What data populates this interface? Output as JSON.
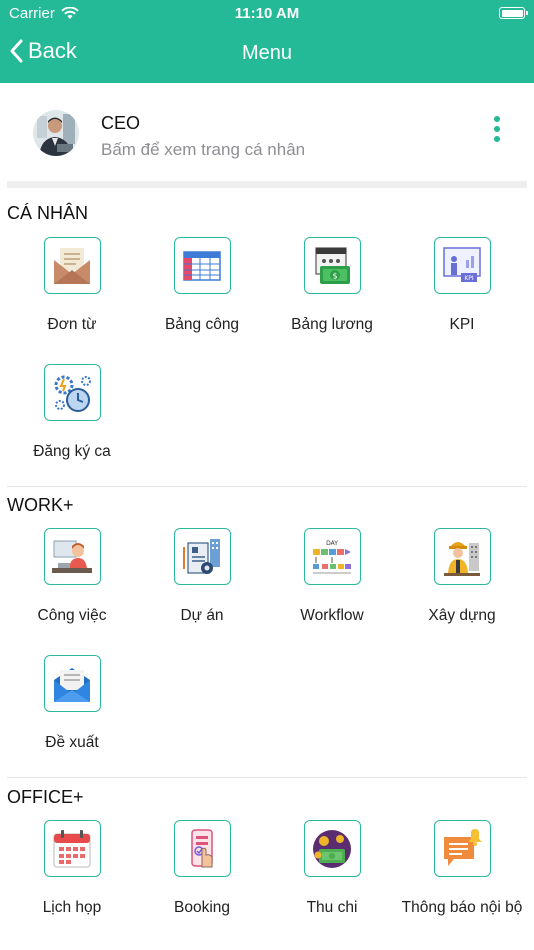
{
  "status_bar": {
    "carrier": "Carrier",
    "time": "11:10 AM"
  },
  "nav": {
    "back_label": "Back",
    "title": "Menu"
  },
  "profile": {
    "name": "CEO",
    "subtitle": "Bấm để xem trang cá nhân"
  },
  "sections": [
    {
      "title": "CÁ NHÂN",
      "items": [
        {
          "label": "Đơn từ",
          "icon": "letter-envelope-icon"
        },
        {
          "label": "Bảng công",
          "icon": "spreadsheet-icon"
        },
        {
          "label": "Bảng lương",
          "icon": "payroll-money-icon"
        },
        {
          "label": "KPI",
          "icon": "kpi-presentation-icon"
        },
        {
          "label": "Đăng ký ca",
          "icon": "shift-clock-gears-icon"
        }
      ]
    },
    {
      "title": "WORK+",
      "items": [
        {
          "label": "Công việc",
          "icon": "person-at-desk-icon"
        },
        {
          "label": "Dự án",
          "icon": "project-documents-icon"
        },
        {
          "label": "Workflow",
          "icon": "workflow-day-icon"
        },
        {
          "label": "Xây dựng",
          "icon": "construction-worker-icon"
        },
        {
          "label": "Đề xuất",
          "icon": "proposal-envelope-icon"
        }
      ]
    },
    {
      "title": "OFFICE+",
      "items": [
        {
          "label": "Lịch họp",
          "icon": "meeting-calendar-icon"
        },
        {
          "label": "Booking",
          "icon": "booking-phone-icon"
        },
        {
          "label": "Thu chi",
          "icon": "income-expense-icon"
        },
        {
          "label": "Thông báo nội bộ",
          "icon": "notification-bell-icon"
        }
      ]
    }
  ],
  "colors": {
    "accent": "#24b997",
    "subtitle": "#8e8e93",
    "tile_border": "#2bb99c"
  }
}
